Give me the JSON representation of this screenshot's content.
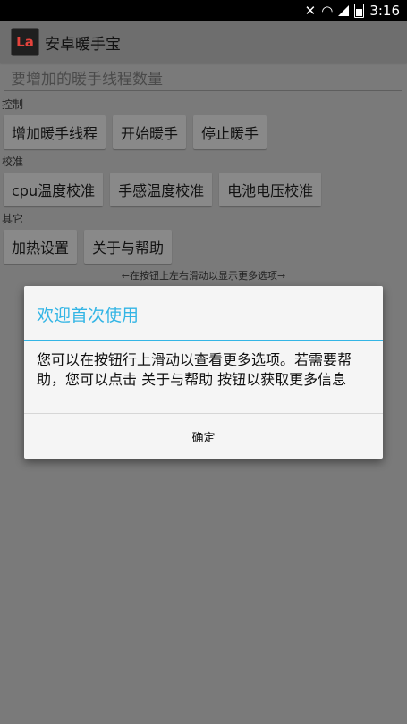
{
  "status_bar": {
    "time": "3:16"
  },
  "app": {
    "logo_text": "La",
    "title": "安卓暖手宝"
  },
  "input": {
    "placeholder": "要增加的暖手线程数量"
  },
  "sections": {
    "control": {
      "label": "控制",
      "buttons": [
        "增加暖手线程",
        "开始暖手",
        "停止暖手"
      ]
    },
    "calibration": {
      "label": "校准",
      "buttons": [
        "cpu温度校准",
        "手感温度校准",
        "电池电压校准"
      ]
    },
    "other": {
      "label": "其它",
      "buttons": [
        "加热设置",
        "关于与帮助"
      ]
    }
  },
  "hint": "←在按钮上左右滑动以显示更多选项→",
  "dialog": {
    "title": "欢迎首次使用",
    "message": "您可以在按钮行上滑动以查看更多选项。若需要帮助，您可以点击 关于与帮助 按钮以获取更多信息",
    "ok_label": "确定"
  },
  "colors": {
    "accent": "#33b5e5",
    "logo_text": "#e5433c"
  }
}
